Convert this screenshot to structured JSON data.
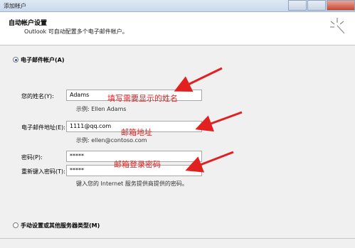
{
  "window": {
    "title": "添加帐户"
  },
  "header": {
    "title": "自动帐户设置",
    "subtitle": "Outlook 可自动配置多个电子邮件帐户。"
  },
  "email_account": {
    "radio_label": "电子邮件帐户(A)",
    "name_label": "您的姓名(Y):",
    "name_value": "Adams",
    "name_hint": "示例: Ellen Adams",
    "email_label": "电子邮件地址(E):",
    "email_value": "1111@qq.com",
    "email_hint": "示例: ellen@contoso.com",
    "password_label": "密码(P):",
    "password_value": "*****",
    "retype_label": "重新键入密码(T):",
    "retype_value": "*****",
    "password_hint": "键入您的 Internet 服务提供商提供的密码。"
  },
  "manual": {
    "radio_label": "手动设置或其他服务器类型(M)"
  },
  "annotations": {
    "name": "填写需要显示的姓名",
    "email": "邮箱地址",
    "password": "邮箱登录密码"
  },
  "colors": {
    "annotation": "#e32020",
    "header_bg": "#ffffff",
    "window_bg": "#f0f0f0"
  }
}
